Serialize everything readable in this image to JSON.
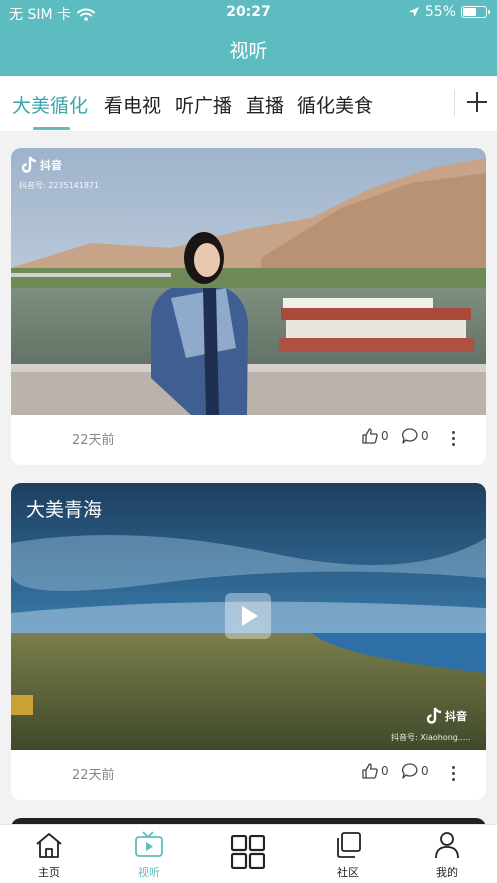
{
  "status_bar": {
    "carrier": "无 SIM 卡",
    "time": "20:27",
    "battery_percent": "55%",
    "battery_level": 0.55,
    "icons": [
      "wifi-icon",
      "location-arrow-icon",
      "battery-icon"
    ]
  },
  "header": {
    "title": "视听"
  },
  "tabs": {
    "items": [
      {
        "label": "大美循化",
        "active": true
      },
      {
        "label": "看电视",
        "active": false
      },
      {
        "label": "听广播",
        "active": false
      },
      {
        "label": "直播",
        "active": false
      },
      {
        "label": "循化美食",
        "active": false
      }
    ],
    "add_icon": "plus-icon"
  },
  "feed": [
    {
      "watermark": "抖音",
      "watermark_id": "抖音号: 2235141871",
      "time_ago": "22天前",
      "likes": "0",
      "comments": "0"
    },
    {
      "title": "大美青海",
      "watermark": "抖音",
      "watermark_id": "抖音号: Xiaohong.....",
      "time_ago": "22天前",
      "likes": "0",
      "comments": "0"
    }
  ],
  "bottom_nav": {
    "items": [
      {
        "label": "主页",
        "icon": "home-icon",
        "active": false
      },
      {
        "label": "视听",
        "icon": "tv-play-icon",
        "active": true
      },
      {
        "label": "",
        "icon": "grid-icon",
        "active": false
      },
      {
        "label": "社区",
        "icon": "community-icon",
        "active": false
      },
      {
        "label": "我的",
        "icon": "user-icon",
        "active": false
      }
    ]
  },
  "colors": {
    "brand": "#5cbcbf",
    "tab_active": "#3aa6ab",
    "text": "#222222",
    "muted": "#888888"
  }
}
